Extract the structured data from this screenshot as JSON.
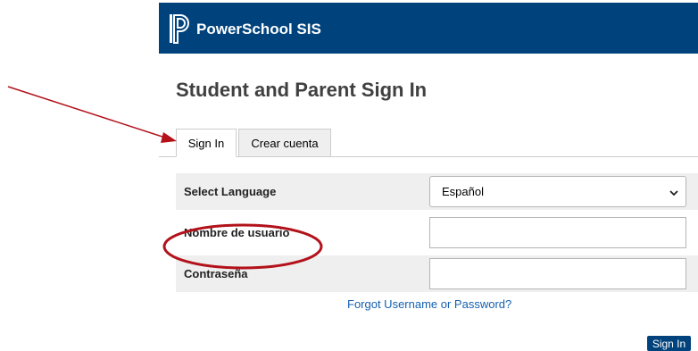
{
  "header": {
    "app_title": "PowerSchool SIS",
    "background_color": "#00427c",
    "logo_icon": "powerschool-logo-icon"
  },
  "page": {
    "title": "Student and Parent Sign In"
  },
  "tabs": [
    {
      "label": "Sign In",
      "active": true
    },
    {
      "label": "Crear cuenta",
      "active": false
    }
  ],
  "form": {
    "language": {
      "label": "Select Language",
      "value": "Español"
    },
    "username": {
      "label": "Nombre de usuario",
      "value": ""
    },
    "password": {
      "label": "Contraseña",
      "value": ""
    },
    "forgot_link": "Forgot Username or Password?",
    "submit_label": "Sign In"
  },
  "annotations": {
    "arrow": "pointing-to-sign-in-tab",
    "ellipse": "highlighting-username-label",
    "color": "#b3121b"
  }
}
